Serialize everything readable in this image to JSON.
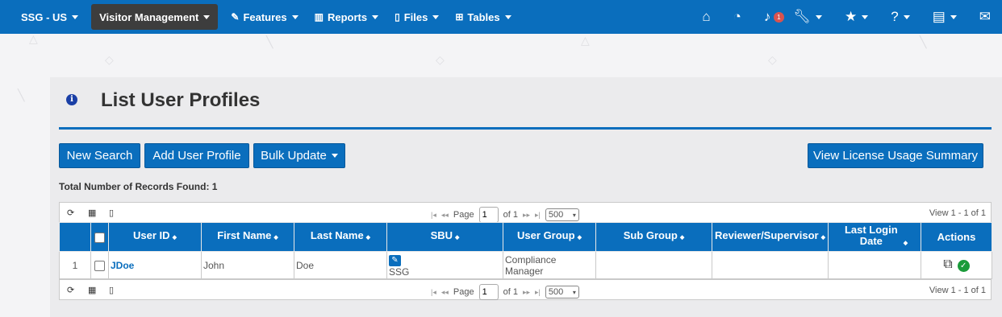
{
  "navbar": {
    "items": [
      {
        "label": "SSG - US"
      },
      {
        "label": "Visitor Management"
      },
      {
        "label": "Features"
      },
      {
        "label": "Reports"
      },
      {
        "label": "Files"
      },
      {
        "label": "Tables"
      }
    ],
    "notification_count": "1",
    "icons": [
      "home-icon",
      "dashboard-icon",
      "bell-icon",
      "wrench-icon",
      "star-icon",
      "help-icon",
      "book-icon",
      "envelope-icon"
    ]
  },
  "page": {
    "title": "List User Profiles",
    "records_found": "Total Number of Records Found: 1"
  },
  "buttons": {
    "new_search": "New Search",
    "add_user_profile": "Add User Profile",
    "bulk_update": "Bulk Update",
    "view_license": "View License Usage Summary"
  },
  "pager": {
    "page_label": "Page",
    "page_value": "1",
    "of_label": "of 1",
    "rows_per_page": "500",
    "view_text": "View 1 - 1 of 1"
  },
  "table": {
    "headers": [
      "User ID",
      "First Name",
      "Last Name",
      "SBU",
      "User Group",
      "Sub Group",
      "Reviewer/Supervisor",
      "Last Login Date",
      "Actions"
    ],
    "rows": [
      {
        "num": "1",
        "user_id": "JDoe",
        "first_name": "John",
        "last_name": "Doe",
        "sbu": "SSG",
        "user_group": "Compliance Manager",
        "sub_group": "",
        "reviewer": "",
        "last_login": ""
      }
    ]
  },
  "colors": {
    "primary": "#0a6ebd",
    "nav_active": "#3d3d3d",
    "badge": "#d9534f",
    "success": "#1a9b3a"
  }
}
